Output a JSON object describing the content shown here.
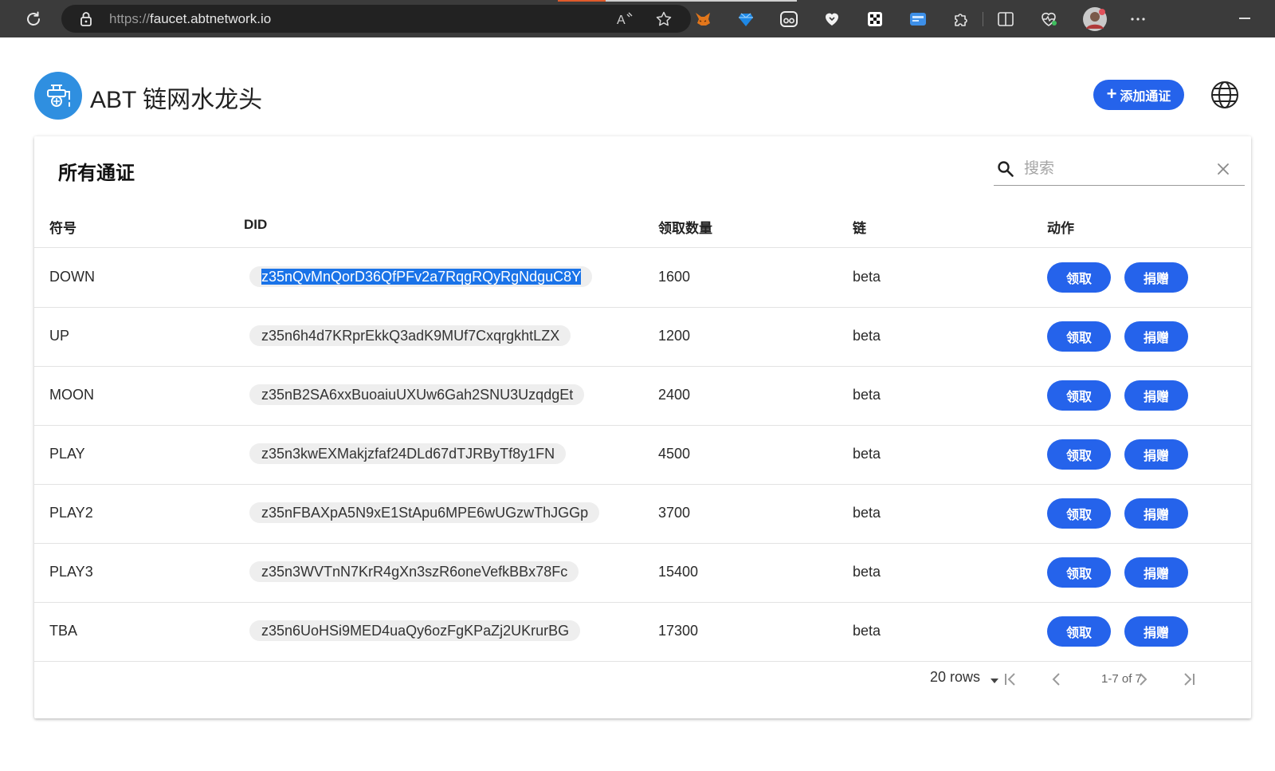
{
  "browser": {
    "url_scheme": "https://",
    "url_host": "faucet.abtnetwork.io",
    "read_aloud_label": "A̅"
  },
  "header": {
    "title": "ABT 链网水龙头",
    "add_token_label": "添加通证"
  },
  "card": {
    "title": "所有通证",
    "search_placeholder": "搜索"
  },
  "table": {
    "columns": [
      "符号",
      "DID",
      "领取数量",
      "链",
      "动作"
    ],
    "rows": [
      {
        "symbol": "DOWN",
        "did": "z35nQvMnQorD36QfPFv2a7RqgRQyRgNdguC8Y",
        "amount": "1600",
        "chain": "beta"
      },
      {
        "symbol": "UP",
        "did": "z35n6h4d7KRprEkkQ3adK9MUf7CxqrgkhtLZX",
        "amount": "1200",
        "chain": "beta"
      },
      {
        "symbol": "MOON",
        "did": "z35nB2SA6xxBuoaiuUXUw6Gah2SNU3UzqdgEt",
        "amount": "2400",
        "chain": "beta"
      },
      {
        "symbol": "PLAY",
        "did": "z35n3kwEXMakjzfaf24DLd67dTJRByTf8y1FN",
        "amount": "4500",
        "chain": "beta"
      },
      {
        "symbol": "PLAY2",
        "did": "z35nFBAXpA5N9xE1StApu6MPE6wUGzwThJGGp",
        "amount": "3700",
        "chain": "beta"
      },
      {
        "symbol": "PLAY3",
        "did": "z35n3WVTnN7KrR4gXn3szR6oneVefkBBx78Fc",
        "amount": "15400",
        "chain": "beta"
      },
      {
        "symbol": "TBA",
        "did": "z35n6UoHSi9MED4uaQy6ozFgKPaZj2UKrurBG",
        "amount": "17300",
        "chain": "beta"
      }
    ],
    "claim_label": "领取",
    "donate_label": "捐赠"
  },
  "pagination": {
    "rows_label": "20 rows",
    "page_info": "1-7 of 7"
  },
  "colors": {
    "primary": "#2563eb",
    "logo": "#2f8fe0",
    "selection": "#1a73e8",
    "chrome": "#3b3b3b"
  },
  "icons": [
    "reload-icon",
    "lock-icon",
    "read-aloud-icon",
    "favorite-star-icon",
    "metamask-fox-icon",
    "gem-extension-icon",
    "owl-extension-icon",
    "heart-extension-icon",
    "qr-extension-icon",
    "card-extension-icon",
    "extensions-puzzle-icon",
    "split-screen-icon",
    "health-icon",
    "profile-avatar",
    "more-icon",
    "minimize-icon",
    "faucet-logo-icon",
    "globe-icon",
    "search-icon",
    "clear-icon",
    "dropdown-icon",
    "first-page-icon",
    "prev-page-icon",
    "next-page-icon",
    "last-page-icon"
  ]
}
